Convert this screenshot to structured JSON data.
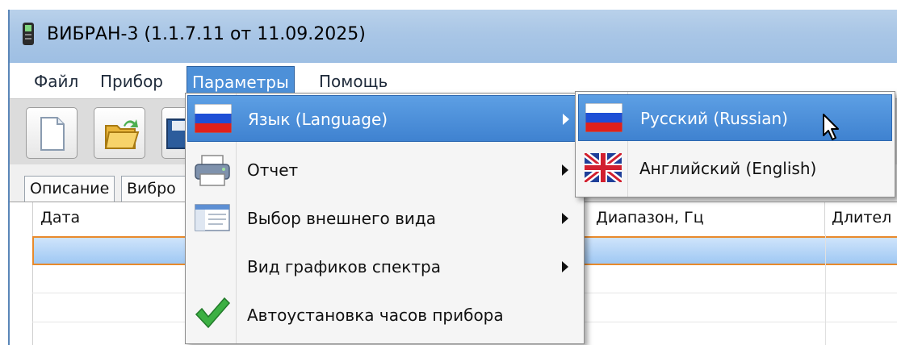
{
  "window": {
    "title": "ВИБРАН-3 (1.1.7.11 от 11.09.2025)"
  },
  "menubar": {
    "items": [
      {
        "label": "Файл"
      },
      {
        "label": "Прибор"
      },
      {
        "label": "Параметры",
        "active": true
      },
      {
        "label": "Помощь"
      }
    ]
  },
  "toolbar": {
    "buttons": [
      "new-document-icon",
      "open-folder-icon",
      "save-icon"
    ]
  },
  "tabs": [
    {
      "label": "Описание"
    },
    {
      "label": "Вибро"
    }
  ],
  "table": {
    "headers": [
      "Дата",
      "Диапазон, Гц",
      "Длител"
    ]
  },
  "parameters_menu": {
    "items": [
      {
        "label": "Язык (Language)",
        "icon": "russian-flag-icon",
        "submenu": true,
        "highlighted": true
      },
      {
        "label": "Отчет",
        "icon": "printer-icon",
        "submenu": true
      },
      {
        "label": "Выбор внешнего вида",
        "icon": "window-layout-icon",
        "submenu": true
      },
      {
        "label": "Вид графиков спектра",
        "icon": "",
        "submenu": true
      },
      {
        "label": "Автоустановка часов прибора",
        "icon": "checkmark-icon",
        "submenu": false,
        "checked": true
      }
    ]
  },
  "language_submenu": {
    "items": [
      {
        "label": "Русский (Russian)",
        "icon": "russian-flag-icon",
        "highlighted": true
      },
      {
        "label": "Английский (English)",
        "icon": "uk-flag-icon"
      }
    ]
  },
  "colors": {
    "menu_highlight": "#3f82d0",
    "titlebar": "#a9c6e6",
    "selected_row_border": "#e88a2c",
    "check_green": "#3cb043"
  }
}
